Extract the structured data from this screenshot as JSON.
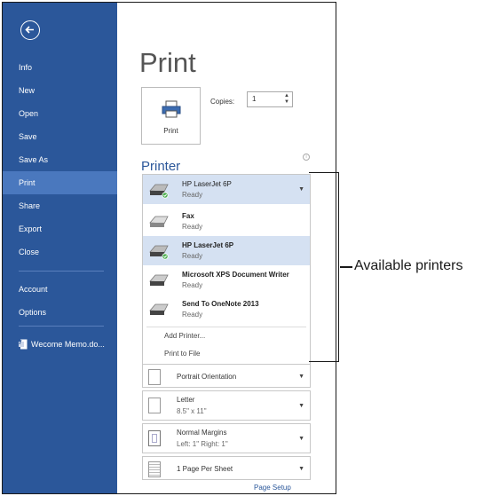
{
  "sidebar": {
    "items": [
      {
        "label": "Info"
      },
      {
        "label": "New"
      },
      {
        "label": "Open"
      },
      {
        "label": "Save"
      },
      {
        "label": "Save As"
      },
      {
        "label": "Print",
        "active": true
      },
      {
        "label": "Share"
      },
      {
        "label": "Export"
      },
      {
        "label": "Close"
      },
      {
        "label": "Account"
      },
      {
        "label": "Options"
      }
    ],
    "recent_document": "Wecome Memo.do..."
  },
  "main": {
    "title": "Print",
    "print_button_label": "Print",
    "copies_label": "Copies:",
    "copies_value": "1",
    "printer_section_title": "Printer",
    "selected_printer": {
      "name": "HP LaserJet 6P",
      "status": "Ready"
    },
    "printers": [
      {
        "name": "Fax",
        "status": "Ready"
      },
      {
        "name": "HP LaserJet 6P",
        "status": "Ready",
        "selected": true
      },
      {
        "name": "Microsoft XPS Document Writer",
        "status": "Ready"
      },
      {
        "name": "Send To OneNote 2013",
        "status": "Ready"
      }
    ],
    "add_printer": "Add Printer...",
    "print_to_file": "Print to File",
    "settings": {
      "orientation": "Portrait Orientation",
      "paper": "Letter",
      "paper_size": "8.5\" x 11\"",
      "margins": "Normal Margins",
      "margins_detail": "Left: 1\"   Right: 1\"",
      "pages_per_sheet": "1 Page Per Sheet"
    },
    "page_setup_link": "Page Setup"
  },
  "annotation": {
    "callout": "Available printers"
  },
  "colors": {
    "sidebar": "#2b579a",
    "sidebar_active": "#4a78be",
    "selection": "#d5e1f2"
  }
}
